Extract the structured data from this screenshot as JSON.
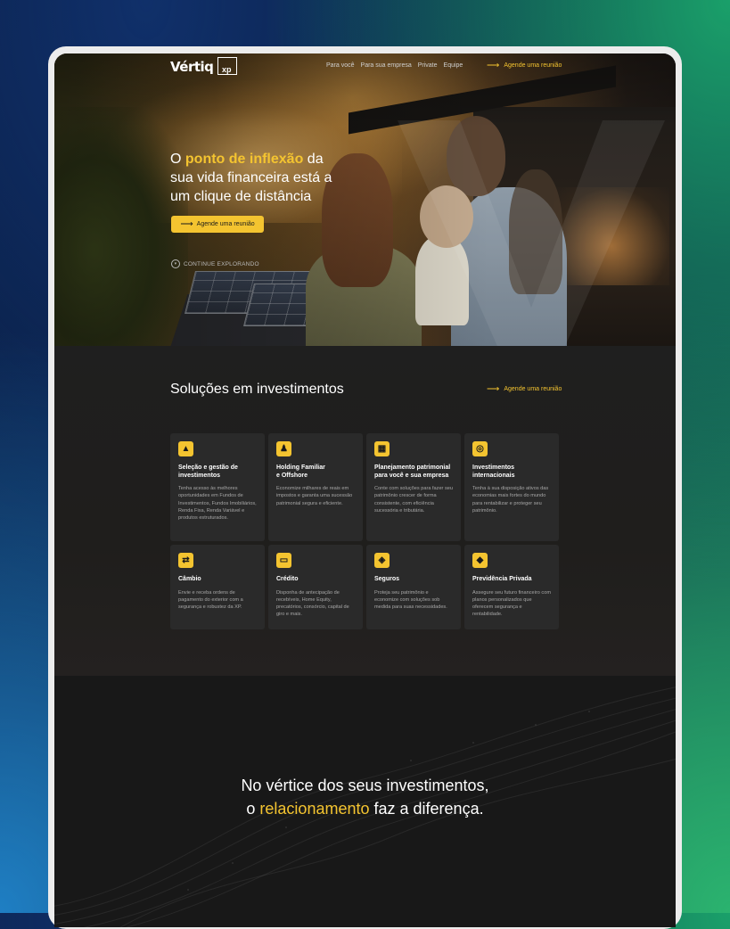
{
  "brand": {
    "logo": "Vértiq",
    "partner": "xp"
  },
  "nav": {
    "items": [
      "Para você",
      "Para sua empresa",
      "Private",
      "Equipe"
    ],
    "cta": "Agende uma reunião"
  },
  "hero": {
    "title_pre": "O ",
    "title_highlight": "ponto de inflexão",
    "title_post": " da sua vida financeira está a um clique de distância",
    "button": "Agende uma reunião",
    "explore": "CONTINUE EXPLORANDO"
  },
  "solutions": {
    "title": "Soluções em investimentos",
    "cta": "Agende uma reunião",
    "cards": [
      {
        "icon": "investment-icon",
        "title": "Seleção e gestão de\ninvestimentos",
        "desc": "Tenha acesso às melhores oportunidades em Fundos de Investimentos, Fundos Imobiliários, Renda Fixa, Renda Variável e produtos estruturados."
      },
      {
        "icon": "family-icon",
        "title": "Holding Familiar\ne Offshore",
        "desc": "Economize milhares de reais em impostos e garanta uma sucessão patrimonial segura e eficiente."
      },
      {
        "icon": "estate-icon",
        "title": "Planejamento patrimonial\npara você e sua empresa",
        "desc": "Conte com soluções para fazer seu patrimônio crescer de forma consistente, com eficiência sucessória e tributária."
      },
      {
        "icon": "global-icon",
        "title": "Investimentos\ninternacionais",
        "desc": "Tenha à sua disposição ativos das economias mais fortes do mundo para rentabilizar e proteger seu patrimônio."
      },
      {
        "icon": "exchange-icon",
        "title": "Câmbio",
        "desc": "Envie e receba ordens de pagamento do exterior com a segurança e robustez da XP."
      },
      {
        "icon": "credit-icon",
        "title": "Crédito",
        "desc": "Disponha de antecipação de recebíveis, Home Equity, precatórios, consórcio, capital de giro e mais."
      },
      {
        "icon": "shield-icon",
        "title": "Seguros",
        "desc": "Proteja seu patrimônio e economize com soluções sob medida para suas necessidades."
      },
      {
        "icon": "pension-icon",
        "title": "Previdência Privada",
        "desc": "Assegure seu futuro financeiro com planos personalizados que oferecem segurança e rentabilidade."
      }
    ]
  },
  "vertex": {
    "line1": "No vértice dos seus investimentos,",
    "line2_pre": "o ",
    "line2_highlight": "relacionamento",
    "line2_post": " faz a diferença."
  },
  "colors": {
    "accent": "#f4c430",
    "dark": "#151515",
    "card": "#2a2a2a"
  }
}
